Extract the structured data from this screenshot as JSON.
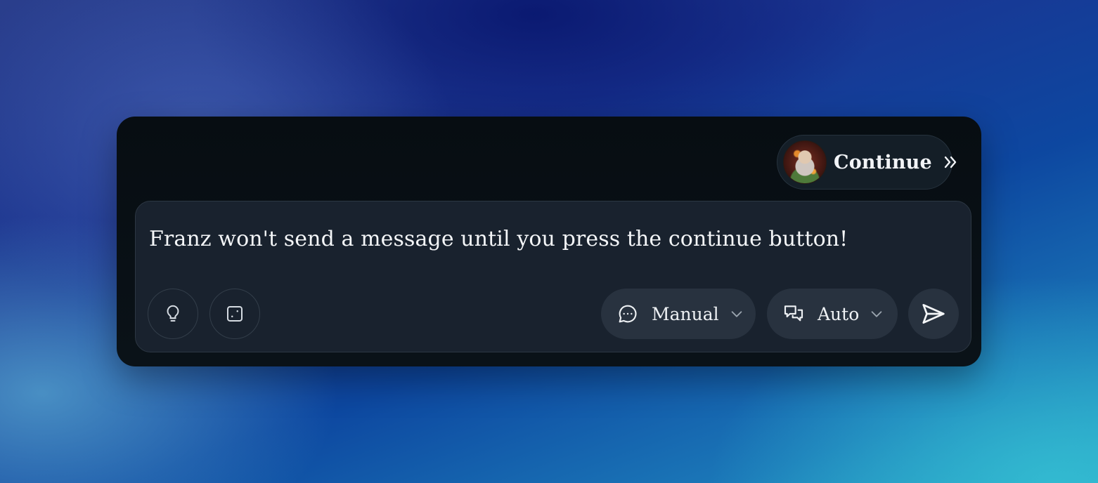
{
  "continue_button": {
    "label": "Continue",
    "avatar_icon": "character-avatar",
    "icon": "chevrons-right-icon"
  },
  "composer": {
    "message": "Franz won't send a message until you press the continue button!",
    "tools": [
      {
        "icon": "lightbulb-icon"
      },
      {
        "icon": "dice-icon"
      }
    ],
    "reply_mode": {
      "label": "Manual",
      "icon": "chat-bubble-icon"
    },
    "conversation_mode": {
      "label": "Auto",
      "icon": "chat-bubbles-icon"
    },
    "send": {
      "icon": "send-icon"
    }
  },
  "colors": {
    "panel_bg": "#070d12",
    "input_bg": "#19222e",
    "pill_bg": "#28323f",
    "text": "#f4f6f8"
  }
}
